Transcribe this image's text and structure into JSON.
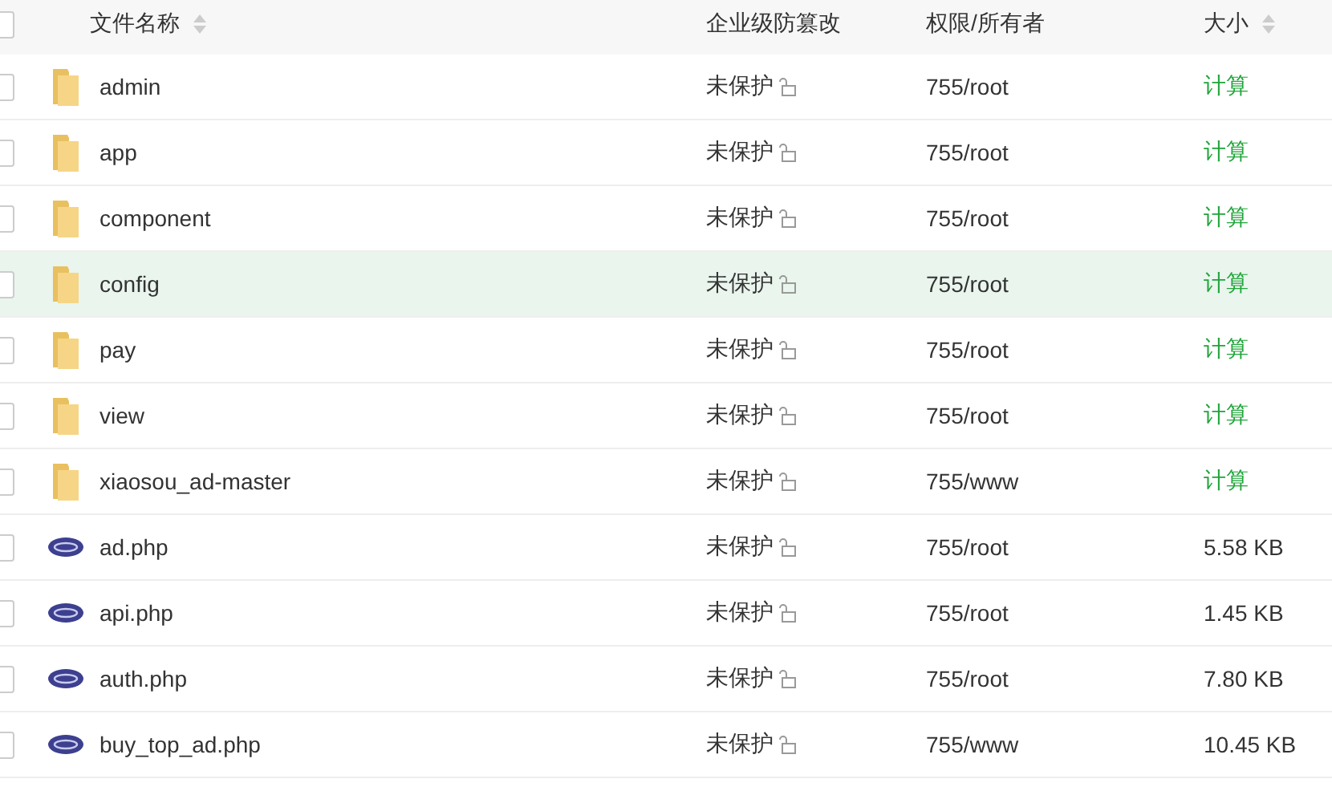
{
  "table": {
    "columns": [
      {
        "label": "文件名称",
        "sortable": true
      },
      {
        "label": "企业级防篡改",
        "sortable": false
      },
      {
        "label": "权限/所有者",
        "sortable": false
      },
      {
        "label": "大小",
        "sortable": true
      }
    ],
    "header_checked": false,
    "rows": [
      {
        "kind": "folder",
        "name": "admin",
        "protection": "未保护",
        "owner": "755/root",
        "size": {
          "kind": "action",
          "text": "计算"
        },
        "checked": false,
        "hovered": false
      },
      {
        "kind": "folder",
        "name": "app",
        "protection": "未保护",
        "owner": "755/root",
        "size": {
          "kind": "action",
          "text": "计算"
        },
        "checked": false,
        "hovered": false
      },
      {
        "kind": "folder",
        "name": "component",
        "protection": "未保护",
        "owner": "755/root",
        "size": {
          "kind": "action",
          "text": "计算"
        },
        "checked": false,
        "hovered": false
      },
      {
        "kind": "folder",
        "name": "config",
        "protection": "未保护",
        "owner": "755/root",
        "size": {
          "kind": "action",
          "text": "计算"
        },
        "checked": false,
        "hovered": true
      },
      {
        "kind": "folder",
        "name": "pay",
        "protection": "未保护",
        "owner": "755/root",
        "size": {
          "kind": "action",
          "text": "计算"
        },
        "checked": false,
        "hovered": false
      },
      {
        "kind": "folder",
        "name": "view",
        "protection": "未保护",
        "owner": "755/root",
        "size": {
          "kind": "action",
          "text": "计算"
        },
        "checked": false,
        "hovered": false
      },
      {
        "kind": "folder",
        "name": "xiaosou_ad-master",
        "protection": "未保护",
        "owner": "755/www",
        "size": {
          "kind": "action",
          "text": "计算"
        },
        "checked": false,
        "hovered": false
      },
      {
        "kind": "php",
        "name": "ad.php",
        "protection": "未保护",
        "owner": "755/root",
        "size": {
          "kind": "value",
          "text": "5.58 KB"
        },
        "checked": false,
        "hovered": false
      },
      {
        "kind": "php",
        "name": "api.php",
        "protection": "未保护",
        "owner": "755/root",
        "size": {
          "kind": "value",
          "text": "1.45 KB"
        },
        "checked": false,
        "hovered": false
      },
      {
        "kind": "php",
        "name": "auth.php",
        "protection": "未保护",
        "owner": "755/root",
        "size": {
          "kind": "value",
          "text": "7.80 KB"
        },
        "checked": false,
        "hovered": false
      },
      {
        "kind": "php",
        "name": "buy_top_ad.php",
        "protection": "未保护",
        "owner": "755/www",
        "size": {
          "kind": "value",
          "text": "10.45 KB"
        },
        "checked": false,
        "hovered": false
      }
    ]
  }
}
